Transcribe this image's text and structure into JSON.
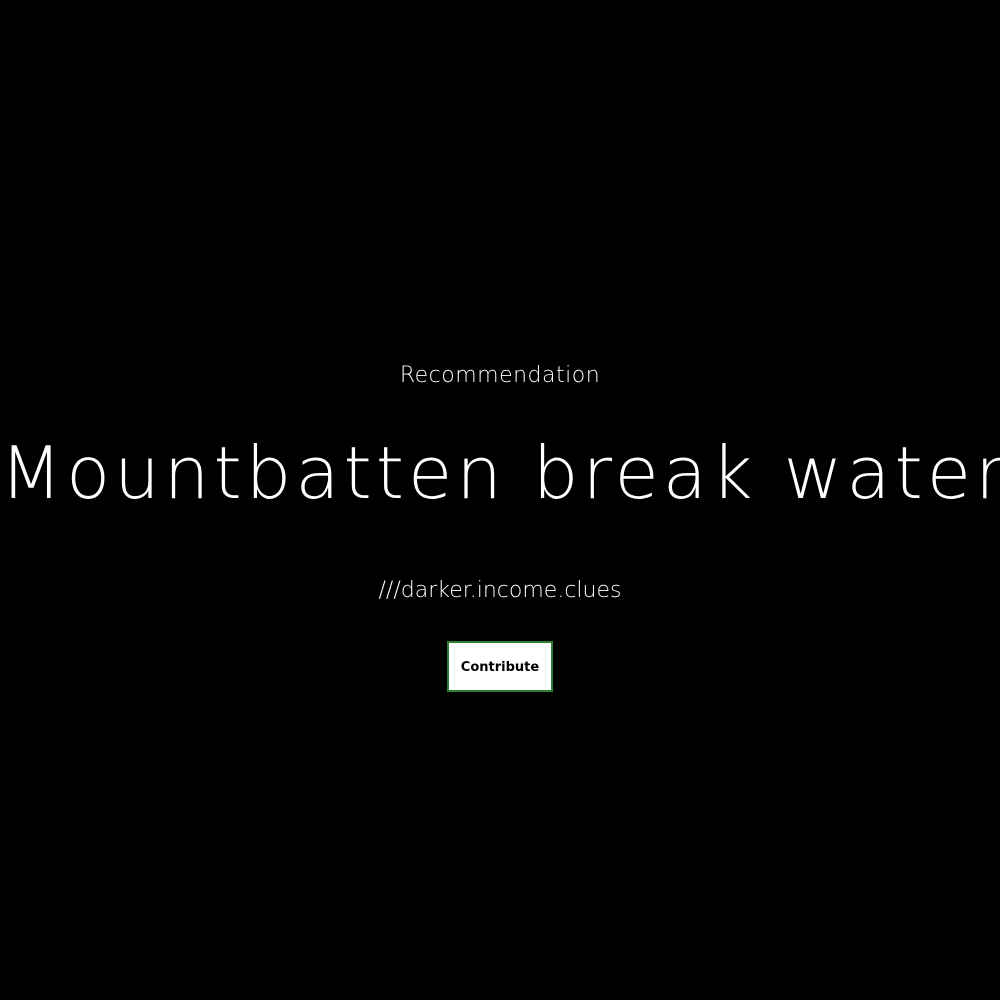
{
  "hero": {
    "eyebrow": "Recommendation",
    "title": "Mountbatten break water",
    "address": "///darker.income.clues",
    "cta_label": "Contribute"
  },
  "colors": {
    "background": "#000000",
    "text": "#ffffff",
    "button_bg": "#ffffff",
    "button_text": "#000000",
    "button_border": "#2e7d32"
  }
}
